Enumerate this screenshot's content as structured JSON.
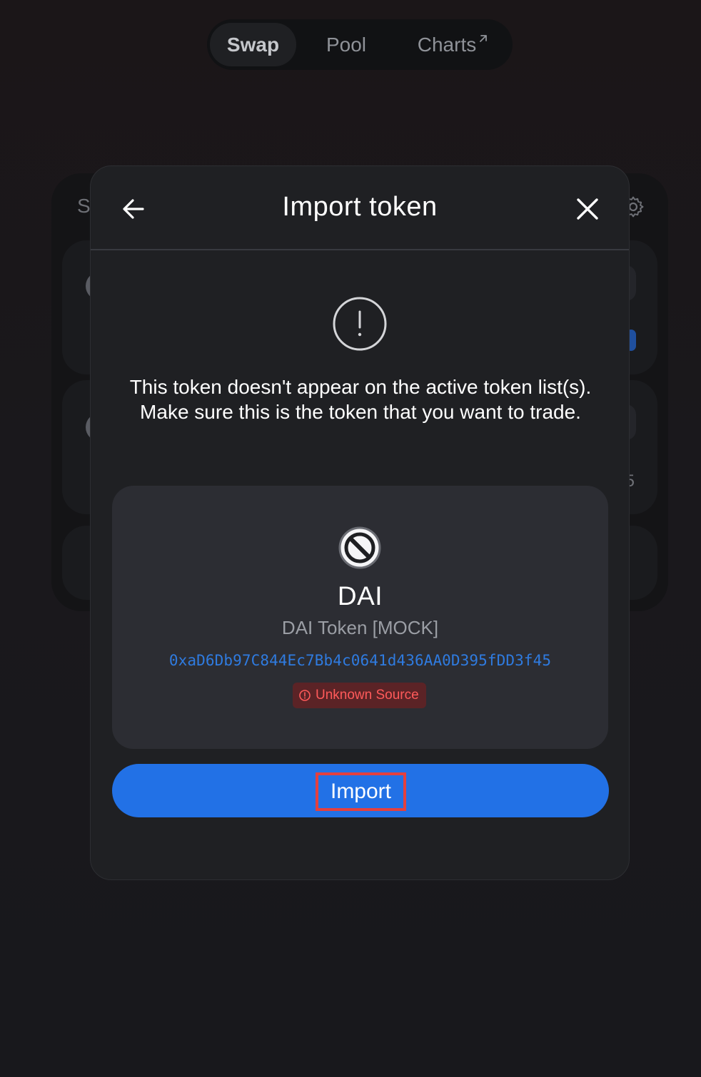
{
  "nav": {
    "tabs": [
      {
        "label": "Swap",
        "active": true
      },
      {
        "label": "Pool",
        "active": false
      },
      {
        "label": "Charts",
        "active": false,
        "icon": "external-arrow-icon"
      }
    ]
  },
  "swap_card": {
    "title_partial": "S",
    "partial_value": "5",
    "icons": [
      "gear-icon"
    ]
  },
  "modal": {
    "title": "Import token",
    "back_icon": "arrow-left-icon",
    "close_icon": "close-icon",
    "warning_icon": "alert-circle-icon",
    "warning_text": "This token doesn't appear on the active token list(s). Make sure this is the token that you want to trade.",
    "token": {
      "logo_icon": "token-unknown-icon",
      "symbol": "DAI",
      "name": "DAI Token [MOCK]",
      "address": "0xaD6Db97C844Ec7Bb4c0641d436AA0D395fDD3f45",
      "source_badge": "Unknown Source",
      "source_badge_icon": "alert-circle-icon"
    },
    "import_button_label": "Import"
  },
  "colors": {
    "accent": "#2271e6",
    "address_link": "#2f7be0",
    "danger": "#ff5a5a",
    "danger_bg": "#5b2326",
    "modal_bg": "#1f2023",
    "card_bg": "#2c2d33",
    "highlight_box": "#e3403f"
  }
}
